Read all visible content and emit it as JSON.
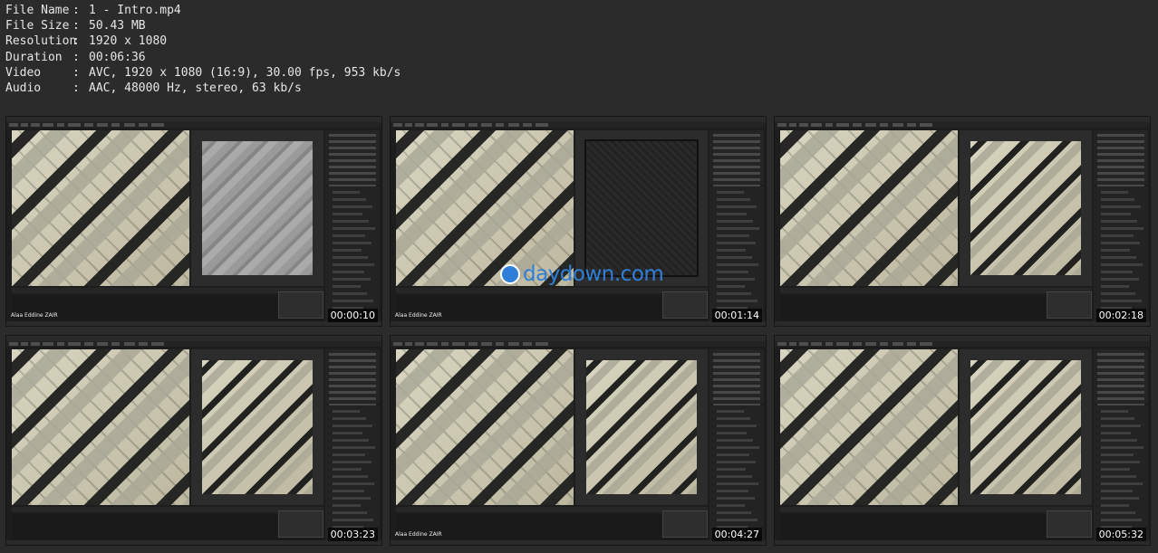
{
  "file_info": [
    {
      "label": "File Name",
      "sep": ":",
      "value": "1 - Intro.mp4"
    },
    {
      "label": "File Size",
      "sep": ":",
      "value": "50.43 MB"
    },
    {
      "label": "Resolution",
      "sep": ":",
      "value": "1920 x 1080"
    },
    {
      "label": "Duration",
      "sep": ":",
      "value": "00:06:36"
    },
    {
      "label": "Video",
      "sep": ":",
      "value": "AVC, 1920 x 1080 (16:9), 30.00 fps, 953 kb/s"
    },
    {
      "label": "Audio",
      "sep": ":",
      "value": "AAC, 48000 Hz, stereo, 63 kb/s"
    }
  ],
  "thumbnails": [
    {
      "time": "00:00:10",
      "author": "Alaa Eddine ZAIR",
      "view": "mesh"
    },
    {
      "time": "00:01:14",
      "author": "Alaa Eddine ZAIR",
      "view": "dark"
    },
    {
      "time": "00:02:18",
      "author": "",
      "view": "photo"
    },
    {
      "time": "00:03:23",
      "author": "",
      "view": "photo"
    },
    {
      "time": "00:04:27",
      "author": "Alaa Eddine ZAIR",
      "view": "photo"
    },
    {
      "time": "00:05:32",
      "author": "",
      "view": "photo"
    }
  ],
  "watermark": {
    "text": "daydown.com",
    "color": "#2f7fd8"
  },
  "colors": {
    "background": "#2b2b2b",
    "text": "#e6e6e6",
    "accent": "#2f7fd8"
  }
}
